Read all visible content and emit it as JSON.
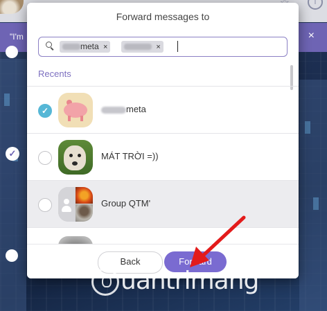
{
  "background": {
    "banner_text": "\"I'm",
    "banner_close": "×"
  },
  "dialog": {
    "title": "Forward messages to",
    "search": {
      "chips": [
        {
          "label": "meta",
          "remove": "×"
        },
        {
          "label": "",
          "remove": "×"
        }
      ]
    },
    "section_label": "Recents",
    "contacts": [
      {
        "name": "meta",
        "selected": true,
        "avatar": "pig-avatar"
      },
      {
        "name": "MÁT TRỜI =))",
        "selected": false,
        "avatar": "dog-avatar"
      },
      {
        "name": "Group QTM'",
        "selected": false,
        "avatar": "group-avatar"
      },
      {
        "name": "",
        "selected": false,
        "avatar": "person-avatar"
      }
    ],
    "buttons": {
      "back": "Back",
      "forward": "Forward"
    }
  },
  "watermark": {
    "text": "uantrimang"
  },
  "colors": {
    "accent": "#7a6bd1",
    "check": "#56b7d6",
    "banner": "#6e64b4",
    "arrow": "#e31b1b"
  }
}
